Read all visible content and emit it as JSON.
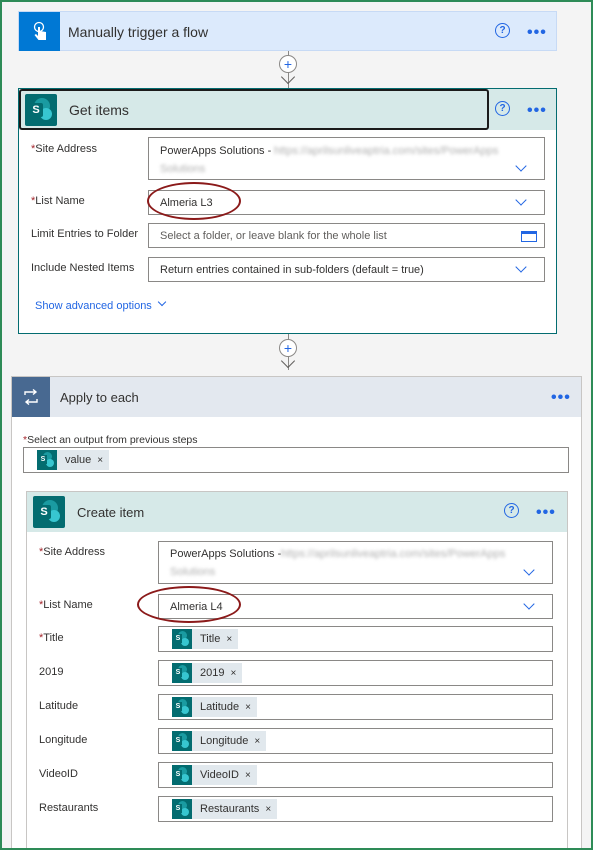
{
  "trigger": {
    "title": "Manually trigger a flow"
  },
  "get_items": {
    "title": "Get items",
    "fields": {
      "site_address_label": "Site Address",
      "site_address_value": "PowerApps Solutions - ",
      "list_name_label": "List Name",
      "list_name_value": "Almeria L3",
      "limit_folder_label": "Limit Entries to Folder",
      "limit_folder_placeholder": "Select a folder, or leave blank for the whole list",
      "nested_label": "Include Nested Items",
      "nested_value": "Return entries contained in sub-folders (default = true)"
    },
    "advanced": "Show advanced options"
  },
  "apply_each": {
    "title": "Apply to each",
    "select_label": "Select an output from previous steps",
    "token": "value"
  },
  "create_item": {
    "title": "Create item",
    "site_address_label": "Site Address",
    "site_address_value": "PowerApps Solutions - ",
    "list_name_label": "List Name",
    "list_name_value": "Almeria L4",
    "rows": [
      {
        "label": "Title",
        "token": "Title",
        "required": true
      },
      {
        "label": "2019",
        "token": "2019",
        "required": false
      },
      {
        "label": "Latitude",
        "token": "Latitude",
        "required": false
      },
      {
        "label": "Longitude",
        "token": "Longitude",
        "required": false
      },
      {
        "label": "VideoID",
        "token": "VideoID",
        "required": false
      },
      {
        "label": "Restaurants",
        "token": "Restaurants",
        "required": false
      }
    ]
  },
  "colors": {
    "accent": "#2266e3",
    "sharepoint": "#036c70",
    "trigger_header": "#dceafc",
    "sp_header": "#d6e9e8",
    "loop_header": "#e3e8ef",
    "loop_icon_bg": "#486991",
    "annotation": "#8b1a1a",
    "frame": "#2e8b57"
  },
  "icons": {
    "help": "?",
    "more": "•••",
    "plus": "+",
    "token_remove": "×"
  }
}
